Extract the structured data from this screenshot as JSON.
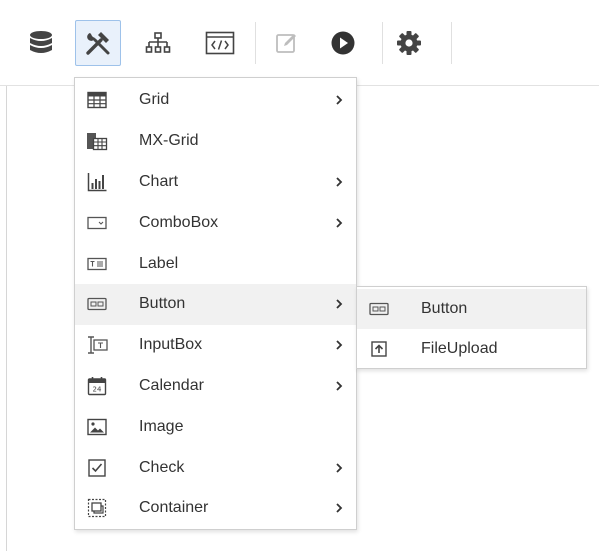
{
  "toolbar": {
    "buttons": [
      {
        "name": "database-icon"
      },
      {
        "name": "tools-icon",
        "active": true
      },
      {
        "name": "hierarchy-icon"
      },
      {
        "name": "code-icon"
      },
      {
        "name": "edit-icon",
        "disabled": true
      },
      {
        "name": "play-icon"
      },
      {
        "name": "gear-icon"
      }
    ]
  },
  "menu": {
    "items": [
      {
        "label": "Grid",
        "icon": "grid-icon",
        "submenu": true
      },
      {
        "label": "MX-Grid",
        "icon": "mx-grid-icon",
        "submenu": false
      },
      {
        "label": "Chart",
        "icon": "chart-icon",
        "submenu": true
      },
      {
        "label": "ComboBox",
        "icon": "combobox-icon",
        "submenu": true
      },
      {
        "label": "Label",
        "icon": "label-icon",
        "submenu": false
      },
      {
        "label": "Button",
        "icon": "button-icon",
        "submenu": true,
        "highlighted": true
      },
      {
        "label": "InputBox",
        "icon": "inputbox-icon",
        "submenu": true
      },
      {
        "label": "Calendar",
        "icon": "calendar-icon",
        "submenu": true
      },
      {
        "label": "Image",
        "icon": "image-icon",
        "submenu": false
      },
      {
        "label": "Check",
        "icon": "check-icon",
        "submenu": true
      },
      {
        "label": "Container",
        "icon": "container-icon",
        "submenu": true
      }
    ]
  },
  "submenu": {
    "items": [
      {
        "label": "Button",
        "icon": "button-icon"
      },
      {
        "label": "FileUpload",
        "icon": "file-upload-icon"
      }
    ]
  },
  "colors": {
    "icon_dark": "#444444",
    "icon_disabled": "#bdbdbd",
    "active_bg": "#e9f1fb",
    "active_border": "#9ec2ea",
    "hover_bg": "#f1f1f1"
  }
}
